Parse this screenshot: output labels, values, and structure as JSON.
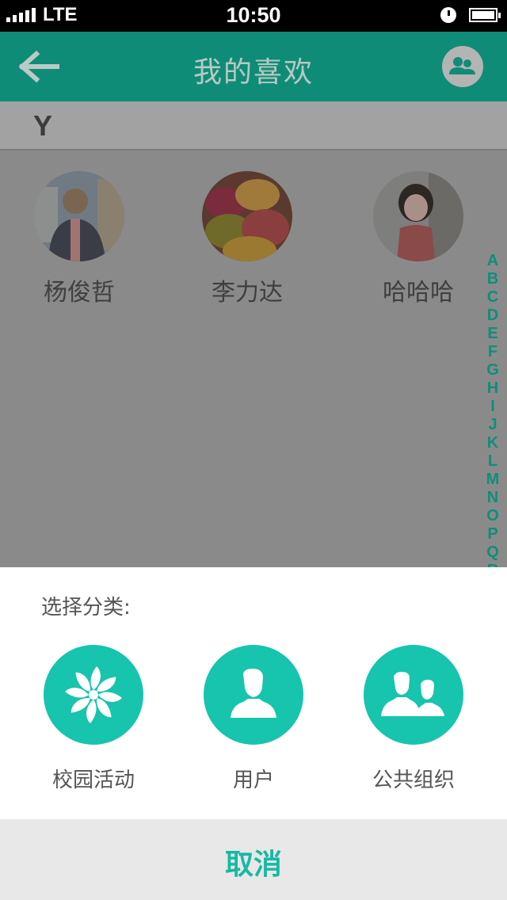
{
  "status_bar": {
    "carrier": "LTE",
    "time": "10:50"
  },
  "nav": {
    "title": "我的喜欢",
    "back_icon": "arrow-left-icon",
    "right_icon": "group-users-icon"
  },
  "list": {
    "section": "Y",
    "people": [
      {
        "name": "杨俊哲"
      },
      {
        "name": "李力达"
      },
      {
        "name": "哈哈哈"
      }
    ],
    "index_letters": [
      "A",
      "B",
      "C",
      "D",
      "E",
      "F",
      "G",
      "H",
      "I",
      "J",
      "K",
      "L",
      "M",
      "N",
      "O",
      "P",
      "Q",
      "R"
    ]
  },
  "sheet": {
    "title": "选择分类:",
    "categories": [
      {
        "label": "校园活动",
        "icon": "pinwheel-icon"
      },
      {
        "label": "用户",
        "icon": "user-icon"
      },
      {
        "label": "公共组织",
        "icon": "users-icon"
      }
    ],
    "cancel": "取消",
    "accent_color": "#17c4ad"
  }
}
